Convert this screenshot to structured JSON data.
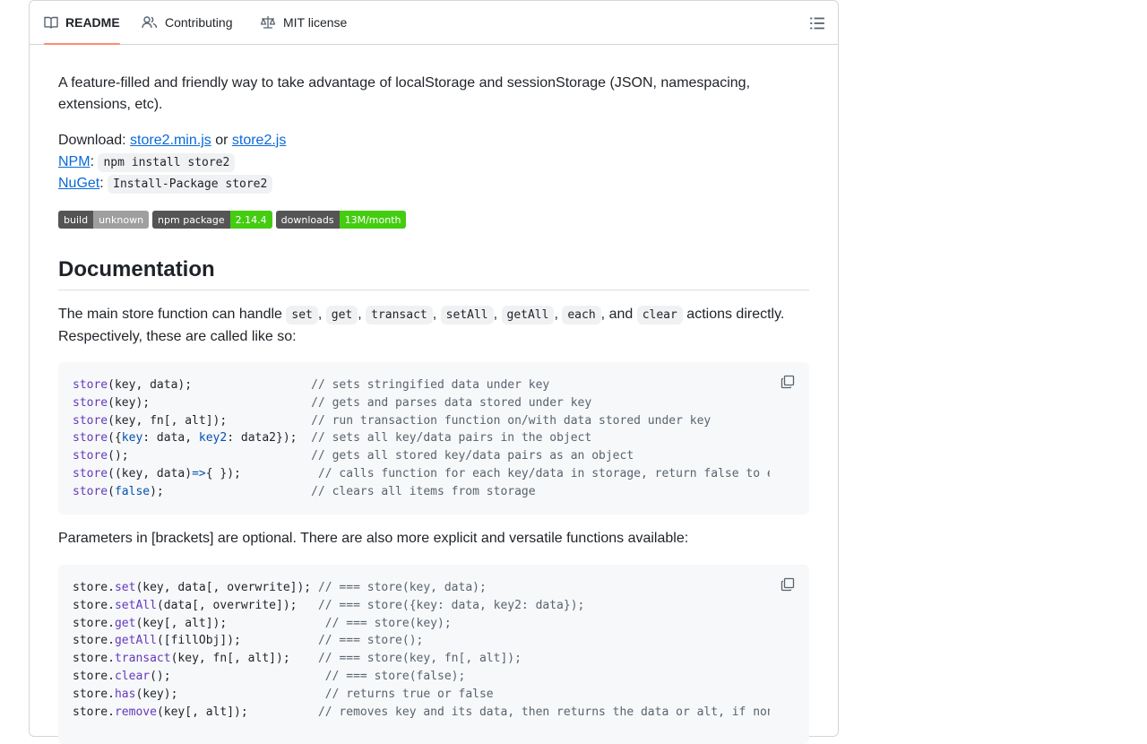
{
  "tabs": [
    {
      "label": "README",
      "icon": "book-icon",
      "active": true
    },
    {
      "label": "Contributing",
      "icon": "people-icon"
    },
    {
      "label": "MIT license",
      "icon": "law-icon"
    }
  ],
  "intro": {
    "line": "A feature-filled and friendly way to take advantage of localStorage and sessionStorage (JSON, namespacing, extensions, etc)."
  },
  "download": {
    "label": "Download: ",
    "link1": "store2.min.js",
    "or": " or ",
    "link2": "store2.js"
  },
  "npm": {
    "label": "NPM",
    "colon": ": ",
    "command": "npm install store2"
  },
  "nuget": {
    "label": "NuGet",
    "colon": ": ",
    "command": "Install-Package store2"
  },
  "badges": [
    {
      "left": "build",
      "right": "unknown",
      "right_color": "#9f9f9f"
    },
    {
      "left": "npm package",
      "right": "2.14.4",
      "right_color": "#4c1"
    },
    {
      "left": "downloads",
      "right": "13M/month",
      "right_color": "#4c1"
    }
  ],
  "documentation": {
    "heading": "Documentation",
    "para_start": "The main store function can handle ",
    "actions": [
      "set",
      "get",
      "transact",
      "setAll",
      "getAll",
      "each"
    ],
    "and": ", and ",
    "last_action": "clear",
    "para_end": " actions directly. Respectively, these are called like so:"
  },
  "code1": [
    [
      [
        "fn",
        "store"
      ],
      [
        "",
        "(key, data);                 "
      ],
      [
        "cm",
        "// sets stringified data under key"
      ]
    ],
    [
      [
        "fn",
        "store"
      ],
      [
        "",
        "(key);                       "
      ],
      [
        "cm",
        "// gets and parses data stored under key"
      ]
    ],
    [
      [
        "fn",
        "store"
      ],
      [
        "",
        "(key, fn[, alt]);            "
      ],
      [
        "cm",
        "// run transaction function on/with data stored under key"
      ]
    ],
    [
      [
        "fn",
        "store"
      ],
      [
        "",
        "({"
      ],
      [
        "kw",
        "key"
      ],
      [
        "",
        ": data, "
      ],
      [
        "kw",
        "key2"
      ],
      [
        "",
        ": data2});  "
      ],
      [
        "cm",
        "// sets all key/data pairs in the object"
      ]
    ],
    [
      [
        "fn",
        "store"
      ],
      [
        "",
        "();                          "
      ],
      [
        "cm",
        "// gets all stored key/data pairs as an object"
      ]
    ],
    [
      [
        "fn",
        "store"
      ],
      [
        "",
        "((key, data)"
      ],
      [
        "kw",
        "=>"
      ],
      [
        "",
        "{ });           "
      ],
      [
        "cm",
        "// calls function for each key/data in storage, return false to exit"
      ]
    ],
    [
      [
        "fn",
        "store"
      ],
      [
        "",
        "("
      ],
      [
        "kw",
        "false"
      ],
      [
        "",
        ");                     "
      ],
      [
        "cm",
        "// clears all items from storage"
      ]
    ]
  ],
  "optional_para": "Parameters in [brackets] are optional. There are also more explicit and versatile functions available:",
  "code2": [
    [
      [
        "",
        "store."
      ],
      [
        "fn",
        "set"
      ],
      [
        "",
        "(key, data[, overwrite]); "
      ],
      [
        "cm",
        "// === store(key, data);"
      ]
    ],
    [
      [
        "",
        "store."
      ],
      [
        "fn",
        "setAll"
      ],
      [
        "",
        "(data[, overwrite]);   "
      ],
      [
        "cm",
        "// === store({key: data, key2: data});"
      ]
    ],
    [
      [
        "",
        "store."
      ],
      [
        "fn",
        "get"
      ],
      [
        "",
        "(key[, alt]);              "
      ],
      [
        "cm",
        "// === store(key);"
      ]
    ],
    [
      [
        "",
        "store."
      ],
      [
        "fn",
        "getAll"
      ],
      [
        "",
        "([fillObj]);           "
      ],
      [
        "cm",
        "// === store();"
      ]
    ],
    [
      [
        "",
        "store."
      ],
      [
        "fn",
        "transact"
      ],
      [
        "",
        "(key, fn[, alt]);    "
      ],
      [
        "cm",
        "// === store(key, fn[, alt]);"
      ]
    ],
    [
      [
        "",
        "store."
      ],
      [
        "fn",
        "clear"
      ],
      [
        "",
        "();                      "
      ],
      [
        "cm",
        "// === store(false);"
      ]
    ],
    [
      [
        "",
        "store."
      ],
      [
        "fn",
        "has"
      ],
      [
        "",
        "(key);                     "
      ],
      [
        "cm",
        "// returns true or false"
      ]
    ],
    [
      [
        "",
        "store."
      ],
      [
        "fn",
        "remove"
      ],
      [
        "",
        "(key[, alt]);          "
      ],
      [
        "cm",
        "// removes key and its data, then returns the data or alt, if none"
      ]
    ]
  ]
}
